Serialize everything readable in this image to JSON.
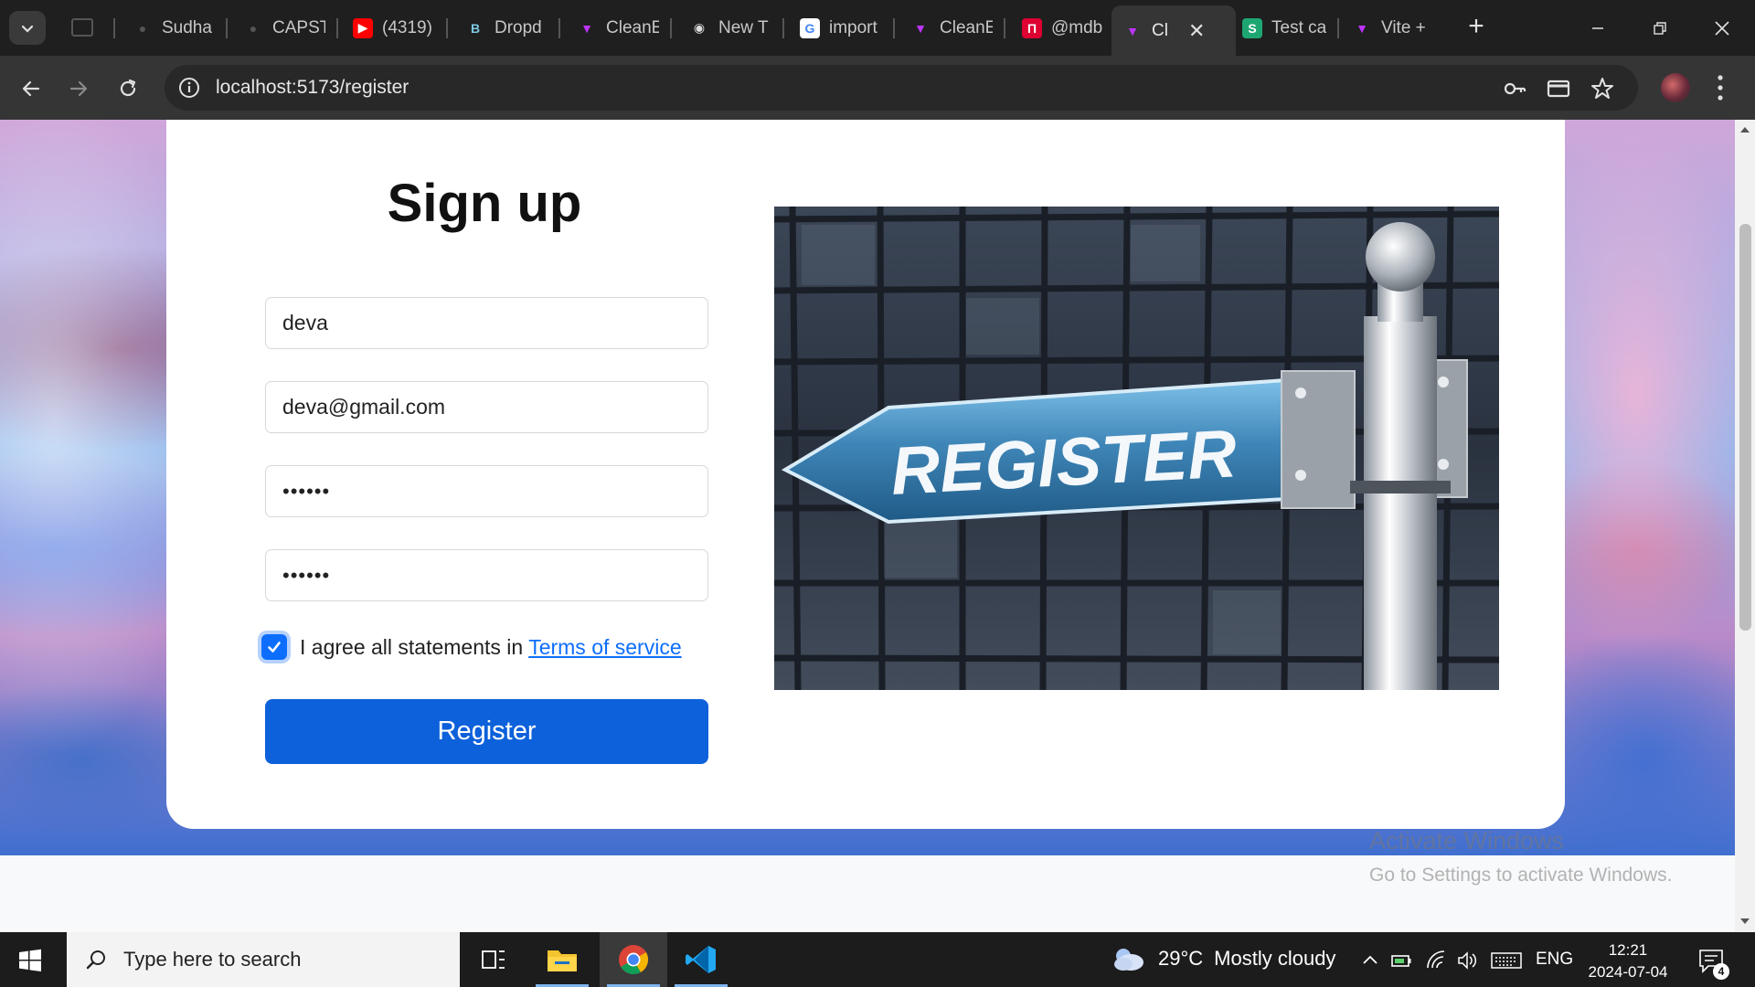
{
  "browser": {
    "tabs": [
      {
        "title": "Sudha",
        "favicon": "github-icon",
        "color": "#2b2b2b"
      },
      {
        "title": "CAPST",
        "favicon": "github-icon",
        "color": "#2b2b2b"
      },
      {
        "title": "(4319)",
        "favicon": "youtube-icon",
        "color": "#ff0000"
      },
      {
        "title": "Dropd",
        "favicon": "bootstrap-icon",
        "color": "#7952b3"
      },
      {
        "title": "CleanE",
        "favicon": "vite-icon",
        "color": "#bd34fe"
      },
      {
        "title": "New T",
        "favicon": "chrome-icon",
        "color": "#ffffff"
      },
      {
        "title": "import",
        "favicon": "google-icon",
        "color": "#4285f4"
      },
      {
        "title": "CleanE",
        "favicon": "vite-icon",
        "color": "#bd34fe"
      },
      {
        "title": "@mdb",
        "favicon": "mdb-icon",
        "color": "#dd0031"
      },
      {
        "title": "Cl",
        "favicon": "vite-icon",
        "color": "#bd34fe",
        "active": true
      },
      {
        "title": "Test ca",
        "favicon": "s-app-icon",
        "color": "#1ea672",
        "letter": "S"
      },
      {
        "title": "Vite +",
        "favicon": "vite-icon",
        "color": "#bd34fe"
      }
    ],
    "url": "localhost:5173/register"
  },
  "form": {
    "title": "Sign up",
    "name_value": "deva",
    "email_value": "deva@gmail.com",
    "password_value": "••••••",
    "confirm_value": "••••••",
    "agree_text": "I agree all statements in",
    "terms_link": "Terms of service",
    "agree_checked": true,
    "register_label": "Register"
  },
  "hero_image": {
    "sign_text": "REGISTER"
  },
  "watermark": {
    "title": "Activate Windows",
    "subtitle": "Go to Settings to activate Windows."
  },
  "taskbar": {
    "search_placeholder": "Type here to search",
    "weather_temp": "29°C",
    "weather_desc": "Mostly cloudy",
    "language": "ENG",
    "time": "12:21",
    "date": "2024-07-04",
    "notification_count": "4"
  },
  "colors": {
    "accent": "#0d6efd",
    "button": "#0d61da",
    "chrome_dark": "#1f1f1f",
    "toolbar": "#353535"
  }
}
